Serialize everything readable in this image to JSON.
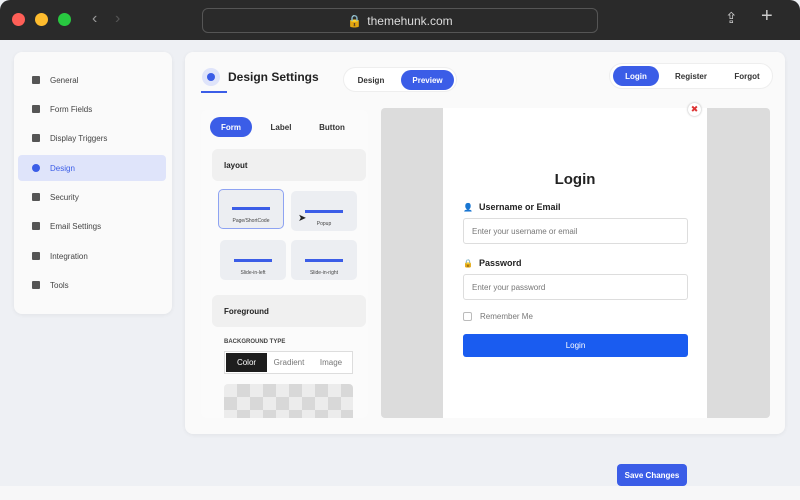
{
  "browser": {
    "url": "themehunk.com"
  },
  "sidebar": {
    "items": [
      {
        "label": "General"
      },
      {
        "label": "Form Fields"
      },
      {
        "label": "Display Triggers"
      },
      {
        "label": "Design",
        "active": true
      },
      {
        "label": "Security"
      },
      {
        "label": "Email Settings"
      },
      {
        "label": "Integration"
      },
      {
        "label": "Tools"
      }
    ]
  },
  "header": {
    "title": "Design Settings",
    "view_tabs": [
      "Design",
      "Preview"
    ],
    "active_view": "Preview",
    "form_tabs": [
      "Login",
      "Register",
      "Forgot"
    ],
    "active_form": "Login"
  },
  "panel": {
    "tabs": [
      "Form",
      "Label",
      "Button"
    ],
    "active_tab": "Form",
    "layout_title": "layout",
    "layouts": [
      "Page/ShortCode",
      "Popup",
      "Slide-in-left",
      "Slide-in-right"
    ],
    "selected_layout": "Page/ShortCode",
    "foreground_title": "Foreground",
    "bg_type_label": "BACKGROUND TYPE",
    "bg_types": [
      "Color",
      "Gradient",
      "Image"
    ],
    "active_bg_type": "Color"
  },
  "preview": {
    "heading": "Login",
    "username_label": "Username or Email",
    "username_placeholder": "Enter your username or email",
    "password_label": "Password",
    "password_placeholder": "Enter your password",
    "remember_label": "Remember Me",
    "submit_label": "Login"
  },
  "footer": {
    "save_label": "Save Changes"
  },
  "colors": {
    "accent": "#3b5de7",
    "submit": "#1a5cf0"
  }
}
